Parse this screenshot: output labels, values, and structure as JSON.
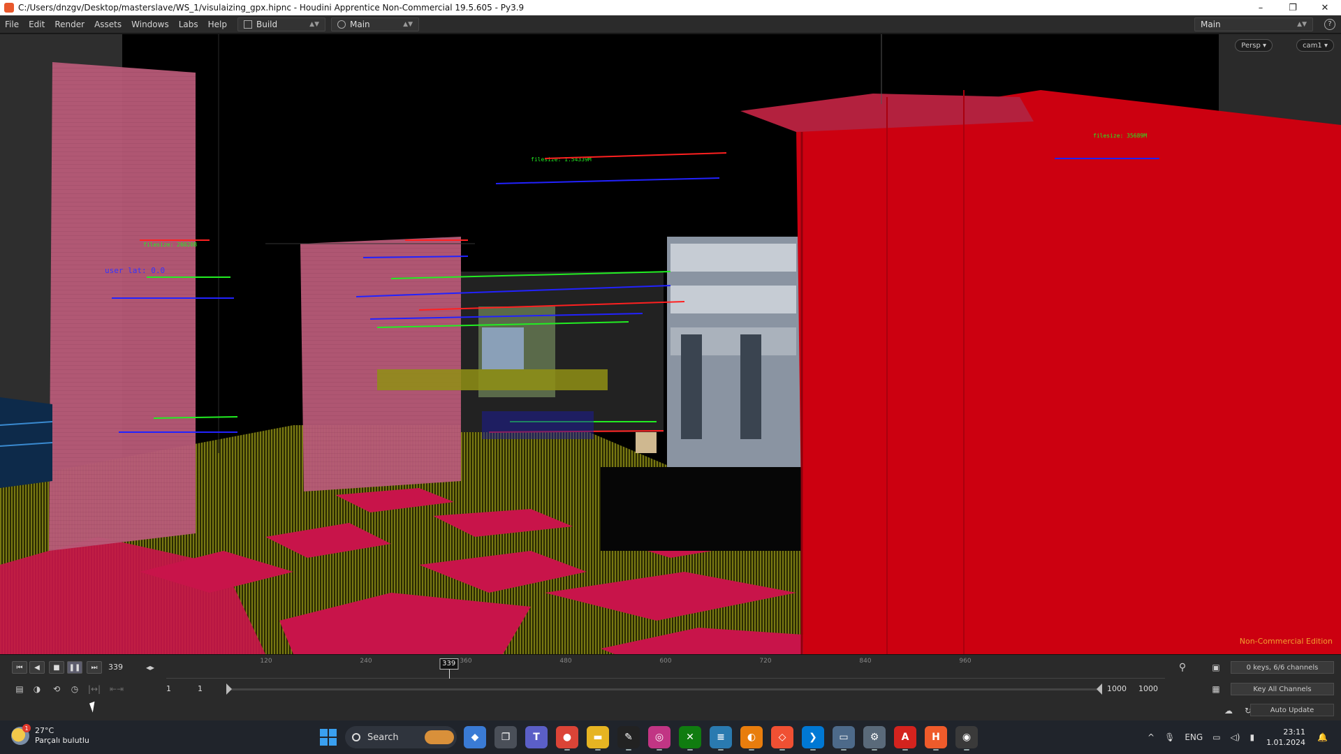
{
  "window": {
    "title": "C:/Users/dnzgv/Desktop/masterslave/WS_1/visulaizing_gpx.hipnc - Houdini Apprentice Non-Commercial 19.5.605 - Py3.9",
    "minimize": "–",
    "maximize": "❐",
    "close": "✕"
  },
  "menu": {
    "items": [
      "File",
      "Edit",
      "Render",
      "Assets",
      "Windows",
      "Labs",
      "Help"
    ],
    "desk1": "Build",
    "desk2": "Main",
    "desk_right": "Main",
    "help_icon": "?"
  },
  "viewport": {
    "persp_label": "Persp ▾",
    "cam_label": "cam1 ▾",
    "watermark": "Non-Commercial Edition",
    "overlay_labels": {
      "filesize_top": "filesize: 1.54339M",
      "filesize_right": "filesize: 35689M",
      "userlat_left": "user lat: 0.0",
      "filesize_left": "filesize: 26020B"
    }
  },
  "timeline": {
    "current_frame": "339",
    "ruler_labels": [
      "120",
      "240",
      "360",
      "480",
      "600",
      "720",
      "840",
      "960"
    ],
    "marker": "339",
    "keys_info": "0 keys, 6/6 channels",
    "key_all": "Key All Channels",
    "range_start": "1",
    "range_start2": "1",
    "range_end": "1000",
    "range_end2": "1000",
    "auto_update": "Auto Update",
    "playback_icons": [
      "⏮",
      "◀",
      "■",
      "❚❚",
      "⏭"
    ],
    "step_icons": "◂▸"
  },
  "taskbar": {
    "weather_temp": "27°C",
    "weather_desc": "Parçalı bulutlu",
    "weather_badge": "1",
    "search": "Search",
    "apps": [
      {
        "name": "widgets",
        "color": "#3a7bd5",
        "glyph": "◆"
      },
      {
        "name": "task-view",
        "color": "#4a4f58",
        "glyph": "❐"
      },
      {
        "name": "teams",
        "color": "#5b5fc7",
        "glyph": "T"
      },
      {
        "name": "chrome",
        "color": "#db4437",
        "glyph": "●"
      },
      {
        "name": "file-explorer",
        "color": "#e6b422",
        "glyph": "▬"
      },
      {
        "name": "inkscape",
        "color": "#222222",
        "glyph": "✎"
      },
      {
        "name": "instagram",
        "color": "#c13584",
        "glyph": "◎"
      },
      {
        "name": "xbox",
        "color": "#107c10",
        "glyph": "✕"
      },
      {
        "name": "notepad",
        "color": "#2a7ab0",
        "glyph": "≡"
      },
      {
        "name": "blender",
        "color": "#e87d0d",
        "glyph": "◐"
      },
      {
        "name": "git",
        "color": "#f05033",
        "glyph": "◇"
      },
      {
        "name": "vscode",
        "color": "#0078d4",
        "glyph": "❯"
      },
      {
        "name": "monitor",
        "color": "#4d6a8a",
        "glyph": "▭"
      },
      {
        "name": "settings",
        "color": "#5a6a7a",
        "glyph": "⚙"
      },
      {
        "name": "acrobat",
        "color": "#d4231e",
        "glyph": "A"
      },
      {
        "name": "houdini",
        "color": "#ef5b2b",
        "glyph": "H"
      },
      {
        "name": "obs",
        "color": "#3a3a3a",
        "glyph": "◉"
      }
    ],
    "tray": {
      "chevron": "^",
      "mic": "🎙",
      "lang": "ENG",
      "time": "23:11",
      "date": "1.01.2024"
    }
  },
  "colors": {
    "building_red": "#cc0010",
    "building_pink": "#b85a78",
    "ground_crimson": "#c8144a",
    "wire_olive": "#8f8f14",
    "label_green": "#22ee22",
    "label_blue": "#2222ff",
    "label_red": "#ff2020"
  }
}
